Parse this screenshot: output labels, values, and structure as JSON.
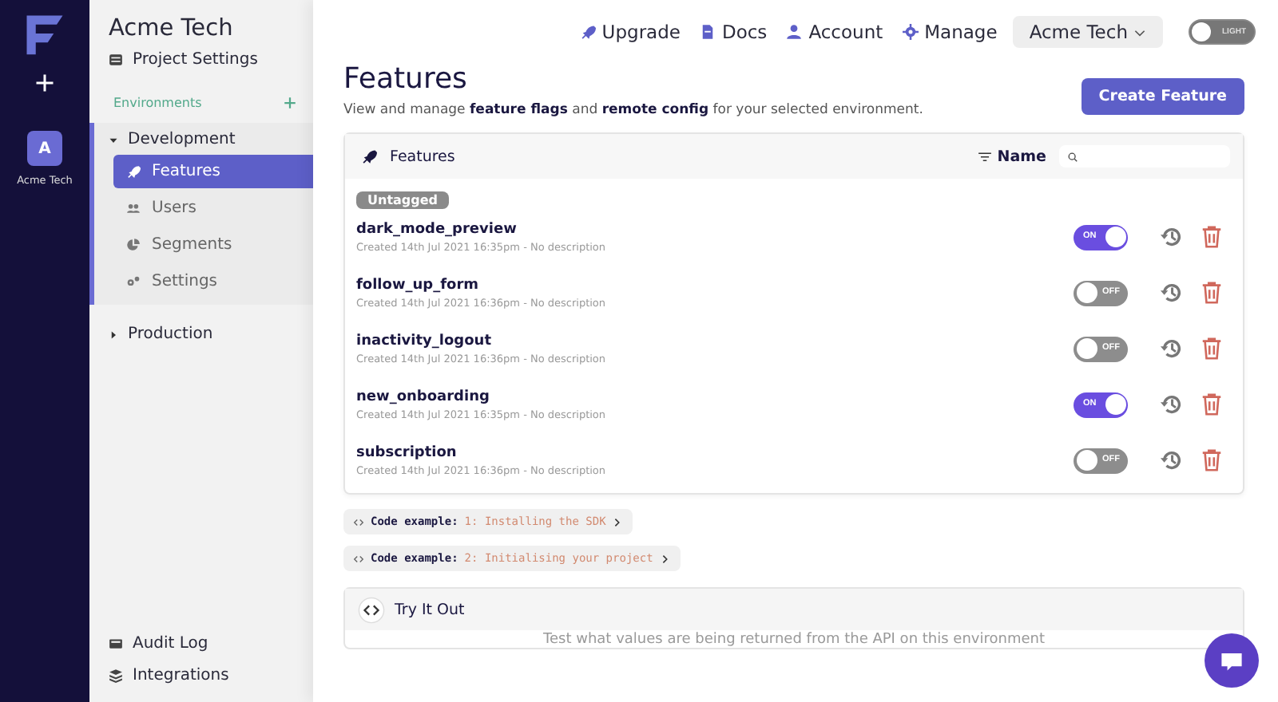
{
  "rail": {
    "org_initial": "A",
    "org_name": "Acme Tech"
  },
  "sidebar": {
    "project": "Acme Tech",
    "project_settings": "Project Settings",
    "environments_label": "Environments",
    "environments": [
      {
        "name": "Development",
        "expanded": true,
        "items": [
          {
            "label": "Features",
            "selected": true
          },
          {
            "label": "Users",
            "selected": false
          },
          {
            "label": "Segments",
            "selected": false
          },
          {
            "label": "Settings",
            "selected": false
          }
        ]
      },
      {
        "name": "Production",
        "expanded": false
      }
    ],
    "footer": [
      {
        "label": "Audit Log"
      },
      {
        "label": "Integrations"
      }
    ]
  },
  "topbar": {
    "links": [
      {
        "label": "Upgrade"
      },
      {
        "label": "Docs"
      },
      {
        "label": "Account"
      },
      {
        "label": "Manage"
      }
    ],
    "org_menu": "Acme Tech",
    "theme_toggle": {
      "label": "LIGHT",
      "on": false
    }
  },
  "page": {
    "title": "Features",
    "subtitle": "View and manage **feature flags** and **remote config** for your selected environment.",
    "create_button": "Create Feature"
  },
  "features_panel": {
    "title": "Features",
    "sort_label": "Name",
    "tag": "Untagged",
    "rows": [
      {
        "name": "dark_mode_preview",
        "meta": "Created 14th Jul 2021 16:35pm - No description",
        "on": true,
        "toggle_label": "ON"
      },
      {
        "name": "follow_up_form",
        "meta": "Created 14th Jul 2021 16:36pm - No description",
        "on": false,
        "toggle_label": "OFF"
      },
      {
        "name": "inactivity_logout",
        "meta": "Created 14th Jul 2021 16:36pm - No description",
        "on": false,
        "toggle_label": "OFF"
      },
      {
        "name": "new_onboarding",
        "meta": "Created 14th Jul 2021 16:35pm - No description",
        "on": true,
        "toggle_label": "ON"
      },
      {
        "name": "subscription",
        "meta": "Created 14th Jul 2021 16:36pm - No description",
        "on": false,
        "toggle_label": "OFF"
      }
    ]
  },
  "code_examples": [
    {
      "label": "Code example:",
      "title": "1: Installing the SDK"
    },
    {
      "label": "Code example:",
      "title": "2: Initialising your project"
    }
  ],
  "try_it": {
    "title": "Try It Out",
    "text": "Test what values are being returned from the API on this environment"
  }
}
